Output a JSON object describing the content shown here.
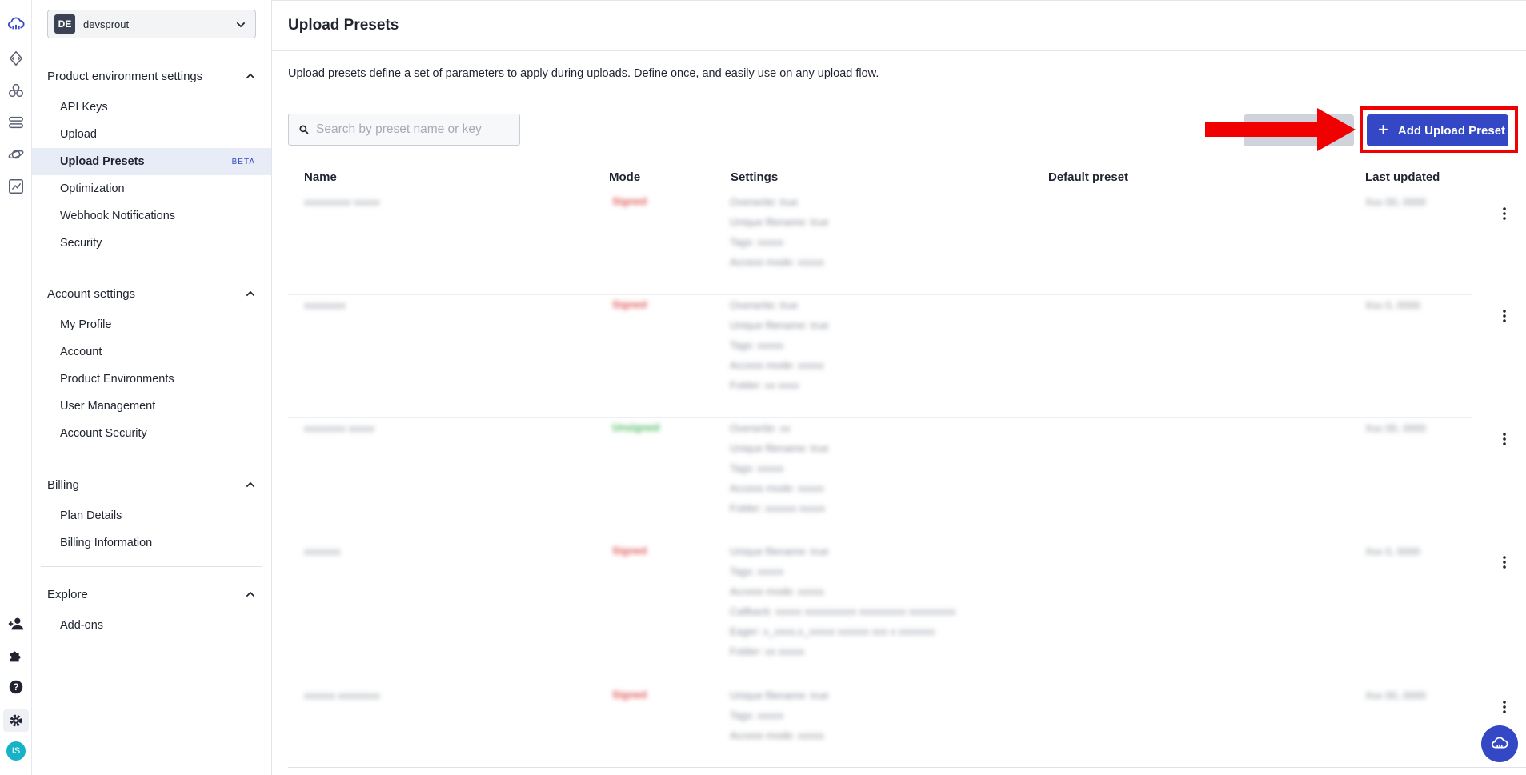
{
  "rail": {
    "top_icons": [
      "cloudinary-logo-icon",
      "code-icon",
      "assets-icon",
      "pipeline-icon",
      "planet-icon",
      "analytics-icon"
    ],
    "bottom_icons": [
      "invite-user-icon",
      "puzzle-icon",
      "help-icon",
      "gear-icon"
    ],
    "avatar": "IS"
  },
  "env": {
    "badge": "DE",
    "name": "devsprout"
  },
  "sidebar": {
    "sections": [
      {
        "title": "Product environment settings",
        "items": [
          "API Keys",
          "Upload",
          "Upload Presets",
          "Optimization",
          "Webhook Notifications",
          "Security"
        ]
      },
      {
        "title": "Account settings",
        "items": [
          "My Profile",
          "Account",
          "Product Environments",
          "User Management",
          "Account Security"
        ]
      },
      {
        "title": "Billing",
        "items": [
          "Plan Details",
          "Billing Information"
        ]
      },
      {
        "title": "Explore",
        "items": [
          "Add-ons"
        ]
      }
    ],
    "active": "Upload Presets",
    "beta_label": "BETA"
  },
  "main": {
    "title": "Upload Presets",
    "description": "Upload presets define a set of parameters to apply during uploads. Define once, and easily use on any upload flow.",
    "search_placeholder": "Search by preset name or key",
    "add_button": "Add Upload Preset",
    "columns": [
      "Name",
      "Mode",
      "Settings",
      "Default preset",
      "Last updated"
    ],
    "rows": [
      {
        "name": "vvvvvvvvv vvvvv",
        "mode": "Signed",
        "mode_color": "#e05a5a",
        "settings": [
          "Overwrite: true",
          "Unique filename: true",
          "Tags: xxxxx",
          "Access mode: xxxxx"
        ],
        "updated": "Xxx 00, 0000"
      },
      {
        "name": "xxxxxxxx",
        "mode": "Signed",
        "mode_color": "#e05a5a",
        "settings": [
          "Overwrite: true",
          "Unique filename: true",
          "Tags: xxxxx",
          "Access mode: xxxxx",
          "Folder: xx xxxx"
        ],
        "updated": "Xxx 0, 0000"
      },
      {
        "name": "xxxxxxxx xxxxx",
        "mode": "Unsigned",
        "mode_color": "#4fba62",
        "settings": [
          "Overwrite: xx",
          "Unique filename: true",
          "Tags: xxxxx",
          "Access mode: xxxxx",
          "Folder: xxxxxx xxxxx"
        ],
        "updated": "Xxx 00, 0000"
      },
      {
        "name": "xxxxxxx",
        "mode": "Signed",
        "mode_color": "#e05a5a",
        "settings": [
          "Unique filename: true",
          "Tags: xxxxx",
          "Access mode: xxxxx",
          "Callback: xxxxx xxxxxxxxxx xxxxxxxxx xxxxxxxxx",
          "Eager: x_xxxx,x_xxxxx xxxxxx xxx x xxxxxxx",
          "Folder: xx xxxxx"
        ],
        "updated": "Xxx 0, 0000"
      },
      {
        "name": "xxxxxx xxxxxxxx",
        "mode": "Signed",
        "mode_color": "#e05a5a",
        "settings": [
          "Unique filename: true",
          "Tags: xxxxx",
          "Access mode: xxxxx"
        ],
        "updated": "Xxx 00, 0000"
      }
    ]
  },
  "colors": {
    "accent": "#3448c5",
    "highlight": "#f00000",
    "active_bg": "#e8ecf7"
  }
}
